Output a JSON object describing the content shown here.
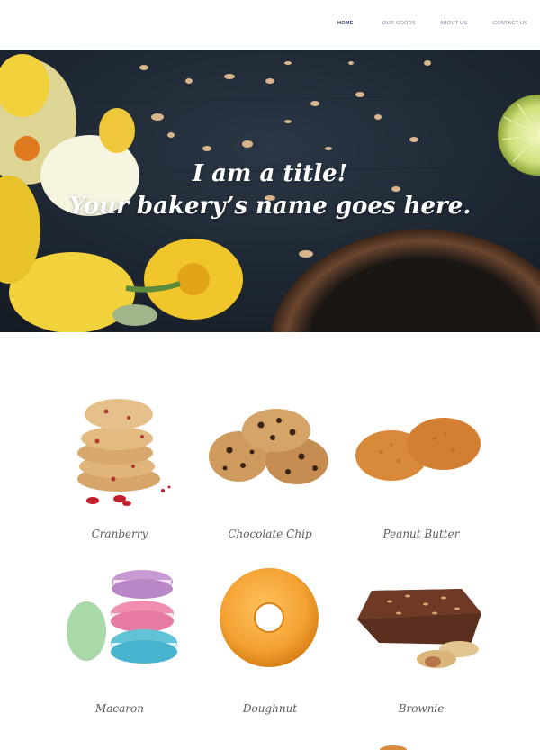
{
  "nav": {
    "items": [
      {
        "label": "HOME",
        "active": true
      },
      {
        "label": "OUR GOODS",
        "active": false
      },
      {
        "label": "ABOUT US",
        "active": false
      },
      {
        "label": "CONTACT US",
        "active": false
      }
    ]
  },
  "hero": {
    "title_line1": "I am a title!",
    "title_line2": "Your bakery’s name goes here."
  },
  "products": [
    {
      "name": "Cranberry"
    },
    {
      "name": "Chocolate Chip"
    },
    {
      "name": "Peanut Butter"
    },
    {
      "name": "Macaron"
    },
    {
      "name": "Doughnut"
    },
    {
      "name": "Brownie"
    }
  ],
  "colors": {
    "nav_active": "#2e3b61",
    "nav_text": "#6e7a96",
    "hero_bg": "#1b2430",
    "hero_text": "#ffffff",
    "product_text": "#5a5a5a"
  }
}
